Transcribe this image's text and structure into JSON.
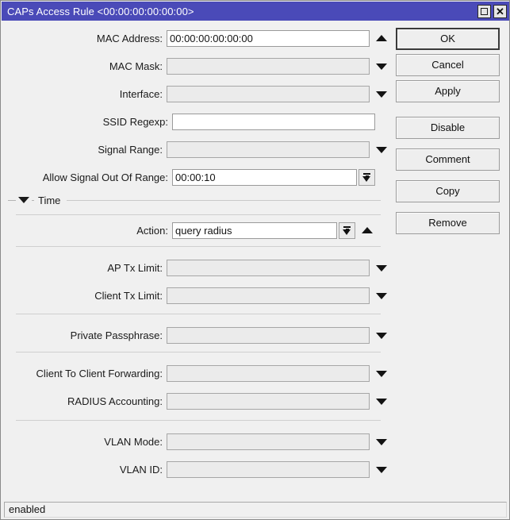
{
  "window": {
    "title": "CAPs Access Rule <00:00:00:00:00:00>",
    "titlebar_buttons": [
      {
        "name": "maximize",
        "glyph": "□"
      },
      {
        "name": "close",
        "glyph": "✕"
      }
    ],
    "accent_color": "#4a4ab8",
    "background_color": "#f0f0f0"
  },
  "form": {
    "rows": [
      {
        "label": "MAC Address:",
        "value": "00:00:00:00:00:00",
        "editable": true,
        "widget": "arrow-up"
      },
      {
        "label": "MAC Mask:",
        "value": "",
        "editable": false,
        "widget": "arrow-down"
      },
      {
        "label": "Interface:",
        "value": "",
        "editable": false,
        "widget": "arrow-down"
      },
      {
        "label": "SSID Regexp:",
        "value": "",
        "editable": true,
        "widget": "none"
      },
      {
        "label": "Signal Range:",
        "value": "",
        "editable": false,
        "widget": "arrow-down"
      },
      {
        "label": "Allow Signal Out Of Range:",
        "value": "00:00:10",
        "editable": true,
        "widget": "dropdown-button"
      },
      {
        "label": "Action:",
        "value": "query radius",
        "editable": true,
        "widget": "dropdown-button-and-arrow-up"
      },
      {
        "label": "AP Tx Limit:",
        "value": "",
        "editable": false,
        "widget": "arrow-down"
      },
      {
        "label": "Client Tx Limit:",
        "value": "",
        "editable": false,
        "widget": "arrow-down"
      },
      {
        "label": "Private Passphrase:",
        "value": "",
        "editable": false,
        "widget": "arrow-down"
      },
      {
        "label": "Client To Client Forwarding:",
        "value": "",
        "editable": false,
        "widget": "arrow-down"
      },
      {
        "label": "RADIUS Accounting:",
        "value": "",
        "editable": false,
        "widget": "arrow-down"
      },
      {
        "label": "VLAN Mode:",
        "value": "",
        "editable": false,
        "widget": "arrow-down"
      },
      {
        "label": "VLAN ID:",
        "value": "",
        "editable": false,
        "widget": "arrow-down"
      }
    ],
    "section": {
      "title": "Time",
      "expanded": true,
      "caret_icon": "chevron-down-icon"
    }
  },
  "buttons": [
    {
      "label": "OK",
      "focused": true
    },
    {
      "label": "Cancel",
      "focused": false
    },
    {
      "label": "Apply",
      "focused": false
    },
    {
      "label": "Disable",
      "focused": false
    },
    {
      "label": "Comment",
      "focused": false
    },
    {
      "label": "Copy",
      "focused": false
    },
    {
      "label": "Remove",
      "focused": false
    }
  ],
  "statusbar": {
    "text": "enabled"
  }
}
